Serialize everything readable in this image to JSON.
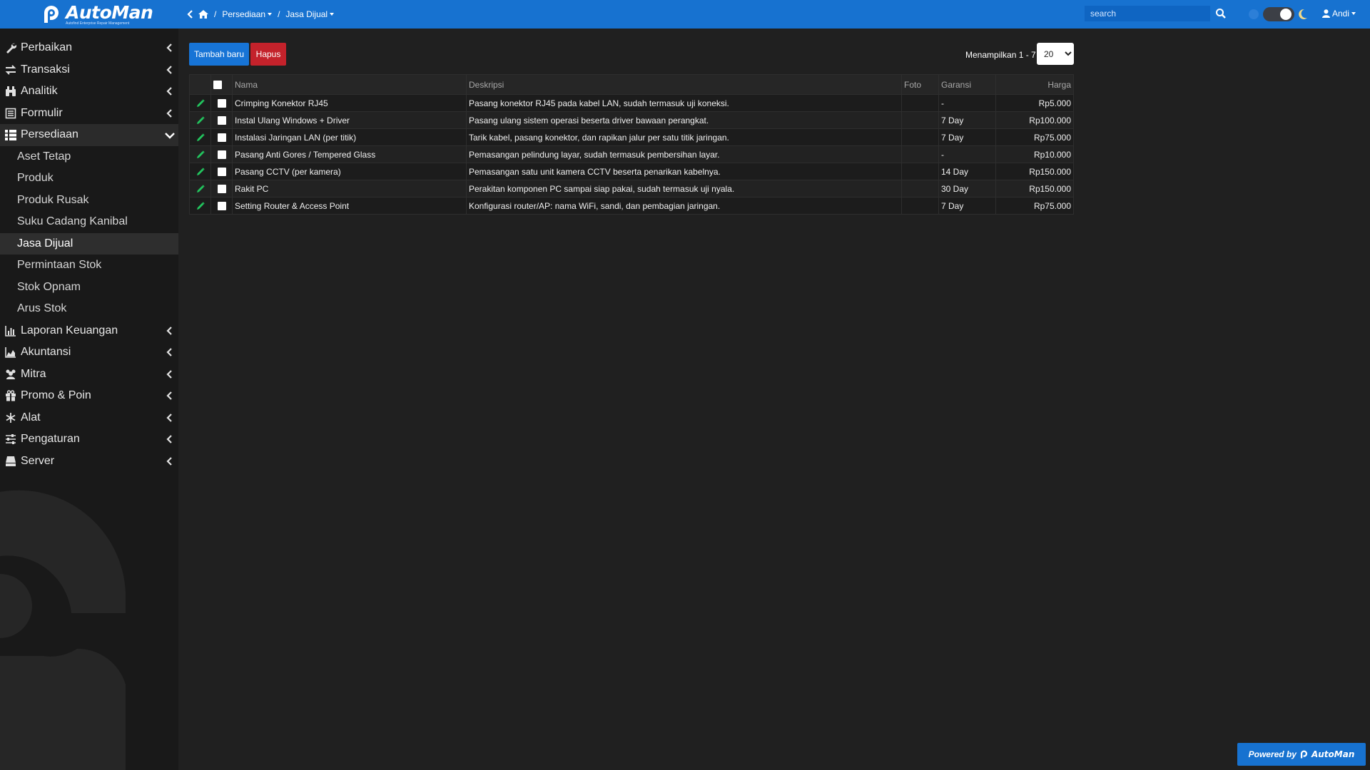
{
  "brand": {
    "name": "AutoMan",
    "tagline": "Autofind Enterprise Repair Management"
  },
  "breadcrumb": {
    "items": [
      "Persediaan",
      "Jasa Dijual"
    ]
  },
  "search": {
    "placeholder": "search"
  },
  "user": {
    "name": "Andi"
  },
  "sidebar": {
    "items": [
      {
        "label": "Perbaikan",
        "icon": "wrench-icon"
      },
      {
        "label": "Transaksi",
        "icon": "exchange-icon"
      },
      {
        "label": "Analitik",
        "icon": "binoculars-icon"
      },
      {
        "label": "Formulir",
        "icon": "form-icon"
      },
      {
        "label": "Persediaan",
        "icon": "grid-icon",
        "open": true
      },
      {
        "label": "Laporan Keuangan",
        "icon": "bar-chart-icon"
      },
      {
        "label": "Akuntansi",
        "icon": "area-chart-icon"
      },
      {
        "label": "Mitra",
        "icon": "users-icon"
      },
      {
        "label": "Promo & Poin",
        "icon": "gift-icon"
      },
      {
        "label": "Alat",
        "icon": "snowflake-icon"
      },
      {
        "label": "Pengaturan",
        "icon": "sliders-icon"
      },
      {
        "label": "Server",
        "icon": "server-icon"
      }
    ],
    "submenu": [
      "Aset Tetap",
      "Produk",
      "Produk Rusak",
      "Suku Cadang Kanibal",
      "Jasa Dijual",
      "Permintaan Stok",
      "Stok Opnam",
      "Arus Stok"
    ],
    "active_submenu": "Jasa Dijual"
  },
  "toolbar": {
    "add_label": "Tambah baru",
    "delete_label": "Hapus",
    "pager_info": "Menampilkan 1 - 7",
    "per_page": "20",
    "per_page_options": [
      "20"
    ]
  },
  "table": {
    "columns": [
      "Nama",
      "Deskripsi",
      "Foto",
      "Garansi",
      "Harga"
    ],
    "rows": [
      {
        "nama": "Crimping Konektor RJ45",
        "deskripsi": "Pasang konektor RJ45 pada kabel LAN, sudah termasuk uji koneksi.",
        "foto": "",
        "garansi": "-",
        "harga": "Rp5.000"
      },
      {
        "nama": "Instal Ulang Windows + Driver",
        "deskripsi": "Pasang ulang sistem operasi beserta driver bawaan perangkat.",
        "foto": "",
        "garansi": "7 Day",
        "harga": "Rp100.000"
      },
      {
        "nama": "Instalasi Jaringan LAN (per titik)",
        "deskripsi": "Tarik kabel, pasang konektor, dan rapikan jalur per satu titik jaringan.",
        "foto": "",
        "garansi": "7 Day",
        "harga": "Rp75.000"
      },
      {
        "nama": "Pasang Anti Gores / Tempered Glass",
        "deskripsi": "Pemasangan pelindung layar, sudah termasuk pembersihan layar.",
        "foto": "",
        "garansi": "-",
        "harga": "Rp10.000"
      },
      {
        "nama": "Pasang CCTV (per kamera)",
        "deskripsi": "Pemasangan satu unit kamera CCTV beserta penarikan kabelnya.",
        "foto": "",
        "garansi": "14 Day",
        "harga": "Rp150.000"
      },
      {
        "nama": "Rakit PC",
        "deskripsi": "Perakitan komponen PC sampai siap pakai, sudah termasuk uji nyala.",
        "foto": "",
        "garansi": "30 Day",
        "harga": "Rp150.000"
      },
      {
        "nama": "Setting Router & Access Point",
        "deskripsi": "Konfigurasi router/AP: nama WiFi, sandi, dan pembagian jaringan.",
        "foto": "",
        "garansi": "7 Day",
        "harga": "Rp75.000"
      }
    ]
  },
  "footer": {
    "powered_by": "Powered by",
    "brand": "AutoMan"
  },
  "colors": {
    "accent": "#1772d0",
    "danger": "#c4222b",
    "edit": "#22c55e"
  }
}
